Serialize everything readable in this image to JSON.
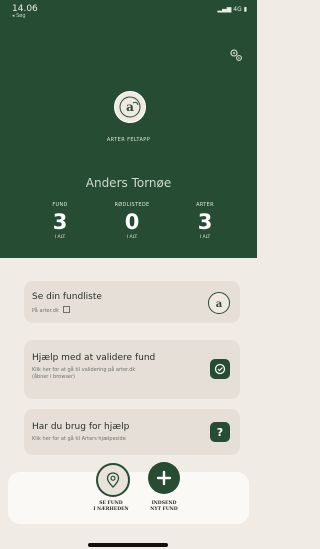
{
  "status": {
    "time": "14.06",
    "back": "◂ Søg",
    "signal": "4G"
  },
  "app": {
    "name": "ARTER FELTAPP"
  },
  "user": {
    "name": "Anders Tornøe"
  },
  "stats": [
    {
      "label": "FUND",
      "value": "3",
      "sub": "I ALT"
    },
    {
      "label": "RØDLISTEDE",
      "value": "0",
      "sub": "I ALT"
    },
    {
      "label": "ARTER",
      "value": "3",
      "sub": "I ALT"
    }
  ],
  "cards": [
    {
      "title": "Se din fundliste",
      "desc": "På arter.dk",
      "icon": "arter-logo-icon"
    },
    {
      "title": "Hjælp med at validere fund",
      "desc1": "Klik her for at gå til validering på arter.dk",
      "desc2": "(åbner i browser)",
      "icon": "validate-icon"
    },
    {
      "title": "Har du brug for hjælp",
      "desc": "Klik her for at gå til Arters hjælpeside",
      "icon": "help-icon",
      "icon_text": "?"
    }
  ],
  "bottom": {
    "nearby_line1": "SE FUND",
    "nearby_line2": "I NÆRHEDEN",
    "submit_line1": "INDSEND",
    "submit_line2": "NYT FUND"
  },
  "colors": {
    "primary": "#264d33",
    "background": "#f0ebe4",
    "card": "#e5dfd7"
  }
}
